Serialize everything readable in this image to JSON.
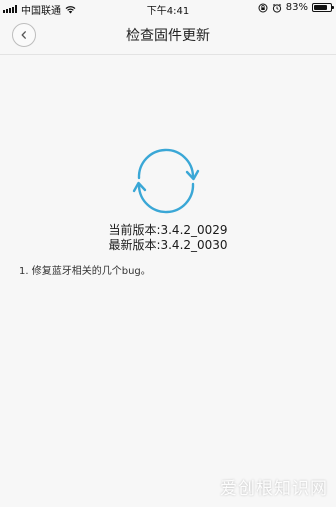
{
  "status_bar": {
    "carrier": "中国联通",
    "time": "下午4:41",
    "battery_percent": "83%",
    "battery_level": 0.83
  },
  "nav": {
    "title": "检查固件更新"
  },
  "firmware": {
    "current_version_line": "当前版本:3.4.2_0029",
    "latest_version_line": "最新版本:3.4.2_0030",
    "changelog": "1. 修复蓝牙相关的几个bug。"
  },
  "watermark": {
    "text": "爱创根知识网"
  },
  "colors": {
    "accent": "#3aa7d6",
    "background": "#f7f7f7"
  },
  "icons": {
    "back": "chevron-left-icon",
    "sync": "sync-icon",
    "wifi": "wifi-icon",
    "lock_rotation": "rotation-lock-icon",
    "alarm": "alarm-icon",
    "battery": "battery-icon"
  }
}
